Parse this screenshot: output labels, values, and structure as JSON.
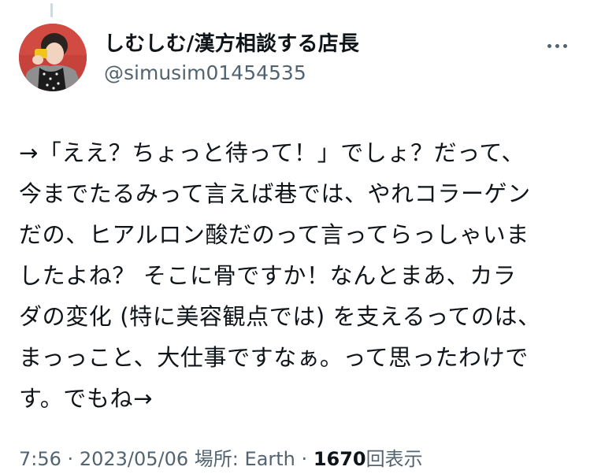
{
  "author": {
    "display_name": "しむしむ/漢方相談する店長",
    "handle": "@simusim01454535",
    "avatar_icon": "user-avatar-photo"
  },
  "more_icon": "more-horizontal-icon",
  "tweet": {
    "lines": [
      "→「ええ？ちょっと待って！」でしょ？だって、",
      "今までたるみって言えば巷では、やれコラーゲン",
      "だの、ヒアルロン酸だのって言ってらっしゃいま",
      "したよね？ そこに骨ですか！なんとまあ、カラ",
      "ダの変化 (特に美容観点では) を支えるってのは、",
      "まっっこと、大仕事ですなぁ。って思ったわけで",
      "す。でもね→"
    ]
  },
  "meta": {
    "time": "7:56",
    "separator": "·",
    "date": "2023/05/06",
    "location_label": "場所:",
    "location": "Earth",
    "views_count": "1670",
    "views_label": "回表示"
  },
  "colors": {
    "text": "#0f1419",
    "secondary": "#536471",
    "avatar_background": "#c7423b"
  }
}
